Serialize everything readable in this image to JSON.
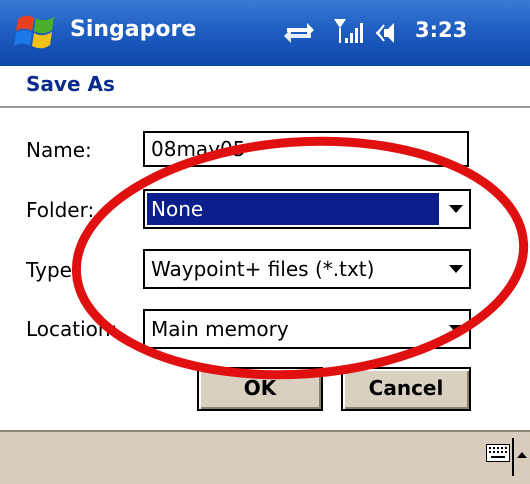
{
  "titlebar": {
    "app_title": "Singapore",
    "clock": "3:23",
    "icons": [
      "windows-start-icon",
      "connectivity-icon",
      "signal-icon",
      "speaker-icon"
    ]
  },
  "dialog": {
    "title": "Save As",
    "fields": {
      "name": {
        "label": "Name:",
        "value": "08may05"
      },
      "folder": {
        "label": "Folder:",
        "value": "None"
      },
      "type": {
        "label": "Type:",
        "value": "Waypoint+ files (*.txt)"
      },
      "location": {
        "label": "Location:",
        "value": "Main memory"
      }
    },
    "buttons": {
      "ok": "OK",
      "cancel": "Cancel"
    }
  },
  "menubar": {
    "icons": [
      "keyboard-icon",
      "sip-arrow-icon"
    ]
  },
  "colors": {
    "titlebar": "#1f5ec2",
    "dialog_title": "#0a2c8c",
    "selection": "#0a1e8c",
    "annotation": "#e01010",
    "menubar": "#d8ccbc"
  }
}
